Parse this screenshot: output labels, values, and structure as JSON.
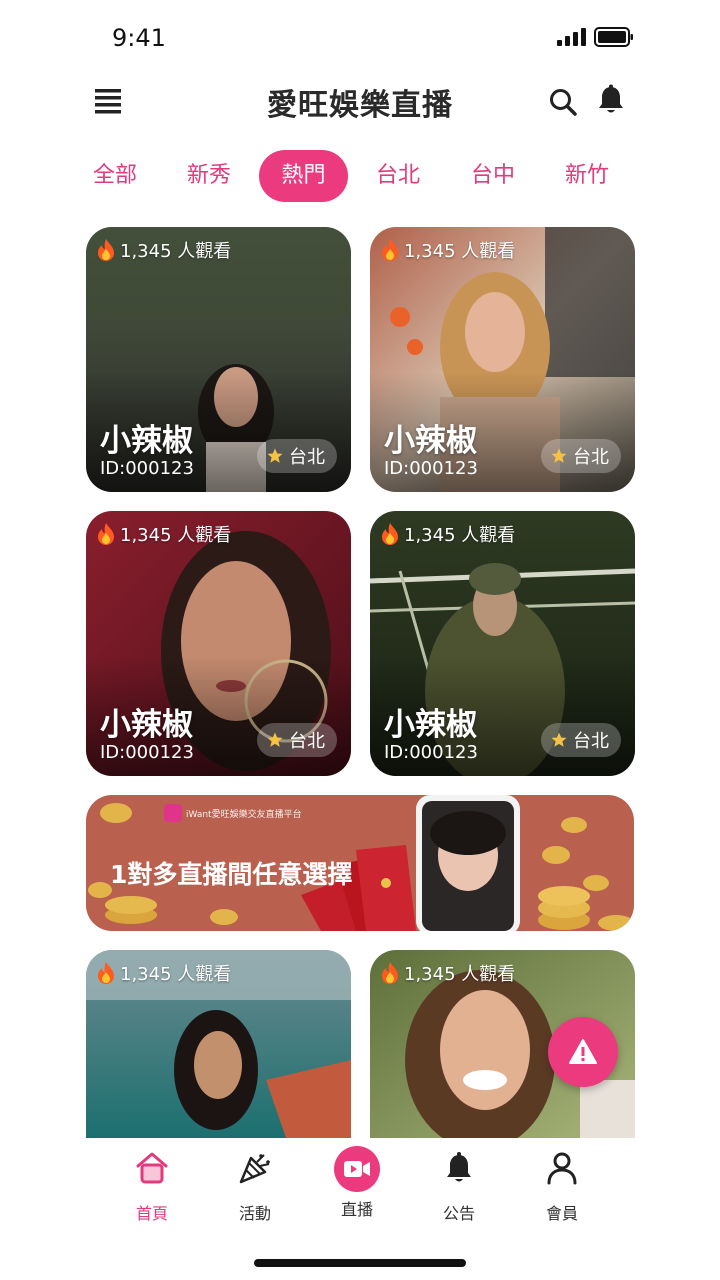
{
  "status_bar": {
    "time": "9:41"
  },
  "header": {
    "title": "愛旺娛樂直播"
  },
  "tabs": [
    {
      "label": "全部"
    },
    {
      "label": "新秀"
    },
    {
      "label": "熱門",
      "active": true
    },
    {
      "label": "台北"
    },
    {
      "label": "台中"
    },
    {
      "label": "新竹"
    }
  ],
  "cards": [
    {
      "viewers": "1,345 人觀看",
      "name": "小辣椒",
      "id": "ID:000123",
      "city": "台北"
    },
    {
      "viewers": "1,345 人觀看",
      "name": "小辣椒",
      "id": "ID:000123",
      "city": "台北"
    },
    {
      "viewers": "1,345 人觀看",
      "name": "小辣椒",
      "id": "ID:000123",
      "city": "台北"
    },
    {
      "viewers": "1,345 人觀看",
      "name": "小辣椒",
      "id": "ID:000123",
      "city": "台北"
    },
    {
      "viewers": "1,345 人觀看"
    },
    {
      "viewers": "1,345 人觀看"
    }
  ],
  "banner": {
    "small_text": "iWant愛旺娛樂交友直播平台",
    "headline": "1對多直播間任意選擇"
  },
  "bottom_nav": [
    {
      "label": "首頁",
      "icon": "home-icon",
      "active": true
    },
    {
      "label": "活動",
      "icon": "party-icon"
    },
    {
      "label": "直播",
      "icon": "video-camera-icon"
    },
    {
      "label": "公告",
      "icon": "bell-icon"
    },
    {
      "label": "會員",
      "icon": "user-icon"
    }
  ],
  "colors": {
    "accent": "#ec3a7f",
    "banner_bg": "#b9604f"
  }
}
